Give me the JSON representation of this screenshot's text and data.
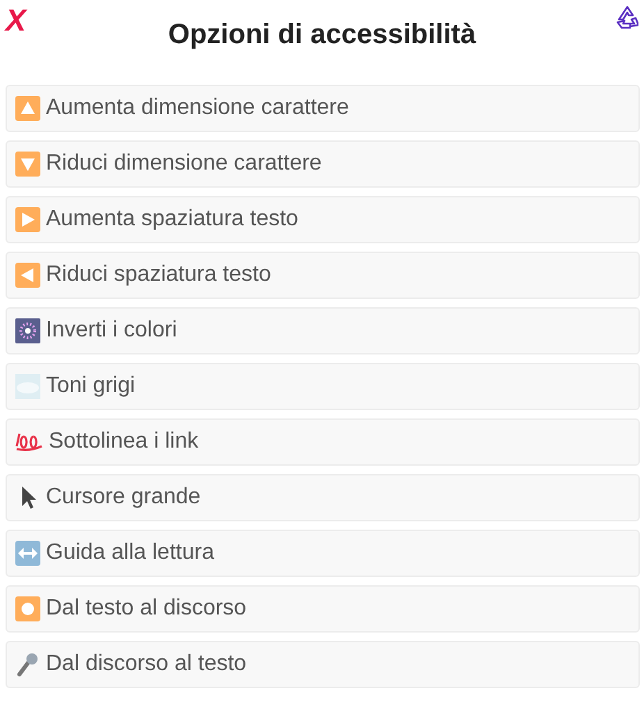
{
  "close_label": "X",
  "title": "Opzioni di accessibilità",
  "options": [
    {
      "kind": "up",
      "label": "Aumenta dimensione carattere"
    },
    {
      "kind": "down",
      "label": "Riduci dimensione carattere"
    },
    {
      "kind": "right",
      "label": "Aumenta spaziatura testo"
    },
    {
      "kind": "left",
      "label": "Riduci spaziatura testo"
    },
    {
      "kind": "fireworks",
      "label": "Inverti i colori"
    },
    {
      "kind": "fog",
      "label": "Toni grigi"
    },
    {
      "kind": "hundred",
      "label": "Sottolinea i link"
    },
    {
      "kind": "cursor",
      "label": "Cursore grande"
    },
    {
      "kind": "leftright",
      "label": "Guida alla lettura"
    },
    {
      "kind": "record",
      "label": "Dal testo al discorso"
    },
    {
      "kind": "mic",
      "label": "Dal discorso al testo"
    }
  ]
}
